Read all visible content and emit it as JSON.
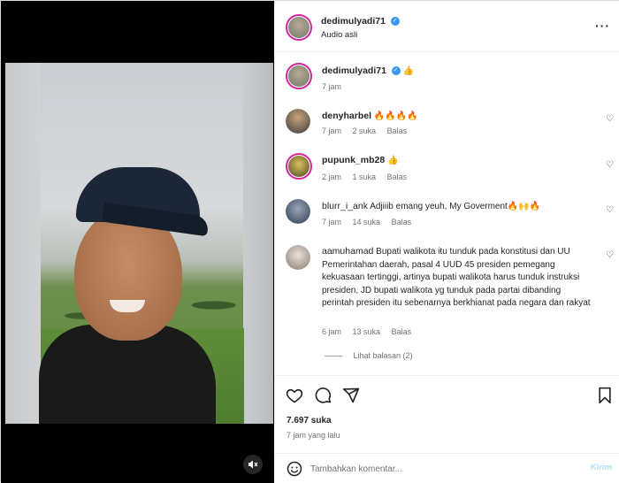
{
  "header": {
    "username": "dedimulyadi71",
    "subtitle": "Audio asli",
    "more_icon": "more-horizontal-icon"
  },
  "caption": {
    "username": "dedimulyadi71",
    "text": "👍",
    "time": "7 jam"
  },
  "comments": [
    {
      "username": "denyharbel",
      "text": "🔥🔥🔥🔥",
      "time": "7 jam",
      "likes": "2 suka",
      "reply": "Balas"
    },
    {
      "username": "pupunk_mb28",
      "text": "👍",
      "time": "2 jam",
      "likes": "1 suka",
      "reply": "Balas"
    },
    {
      "username": "blurr_i_ank",
      "text": "Adjiiib emang yeuh, My Goverment🔥🙌🔥",
      "time": "7 jam",
      "likes": "14 suka",
      "reply": "Balas"
    },
    {
      "username": "aamuhamad",
      "text": "Bupati walikota itu tunduk pada konstitusi dan UU Pemerintahan daerah, pasal 4 UUD 45 presiden pemegang kekuasaan tertinggi, artinya bupati walikota harus tunduk instruksi presiden, JD bupati walikota yg tunduk pada partai dibanding perintah presiden itu sebenarnya berkhianat pada negara dan rakyat",
      "time": "6 jam",
      "likes": "13 suka",
      "reply": "Balas"
    }
  ],
  "view_replies": "Lihat balasan (2)",
  "actions": {
    "likes": "7.697 suka",
    "posted": "7 jam yang lalu"
  },
  "composer": {
    "placeholder": "Tambahkan komentar...",
    "send_label": "Kirim"
  },
  "colors": {
    "verified": "#3897f0",
    "story_ring": "#d6249f",
    "send_disabled": "#b2dffc"
  }
}
